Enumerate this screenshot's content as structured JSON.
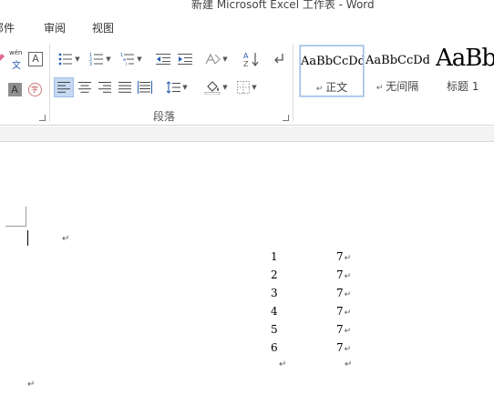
{
  "window": {
    "title": "新建 Microsoft Excel 工作表 - Word"
  },
  "tabs": [
    {
      "label": "邮件"
    },
    {
      "label": "审阅"
    },
    {
      "label": "视图"
    }
  ],
  "font_group": {
    "phonetic_label": "wén",
    "phonetic_char": "文",
    "border_char": "A",
    "shading_char": "A",
    "enclose_char": "字"
  },
  "paragraph_group": {
    "label": "段落"
  },
  "styles_group": {
    "items": [
      {
        "sample": "AaBbCcDd",
        "name": "正文",
        "selected": true
      },
      {
        "sample": "AaBbCcDd",
        "name": "无间隔",
        "selected": false
      },
      {
        "sample": "AaBb",
        "name": "标题 1",
        "selected": false
      }
    ]
  },
  "document": {
    "paragraph_mark": "↵",
    "rows": [
      {
        "left": "1",
        "right": "7"
      },
      {
        "left": "2",
        "right": "7"
      },
      {
        "left": "3",
        "right": "7"
      },
      {
        "left": "4",
        "right": "7"
      },
      {
        "left": "5",
        "right": "7"
      },
      {
        "left": "6",
        "right": "7"
      }
    ]
  }
}
